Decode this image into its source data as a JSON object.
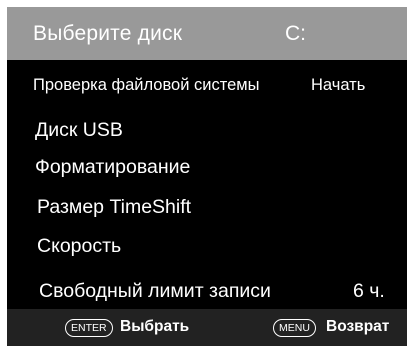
{
  "header": {
    "title": "Выберите диск",
    "value": "C:"
  },
  "menu": {
    "fs_check": {
      "label": "Проверка файловой системы",
      "value": "Начать"
    },
    "usb_disk": {
      "label": "Диск USB"
    },
    "format": {
      "label": "Форматирование"
    },
    "timeshift_size": {
      "label": "Размер TimeShift"
    },
    "speed": {
      "label": "Скорость"
    },
    "free_limit": {
      "label": "Свободный лимит записи",
      "value": "6 ч."
    }
  },
  "footer": {
    "enter_key": "ENTER",
    "enter_label": "Выбрать",
    "menu_key": "MENU",
    "menu_label": "Возврат"
  },
  "colors": {
    "header_bg": "#999999",
    "panel_bg": "#000000",
    "footer_bg": "#222222",
    "text": "#ffffff"
  }
}
